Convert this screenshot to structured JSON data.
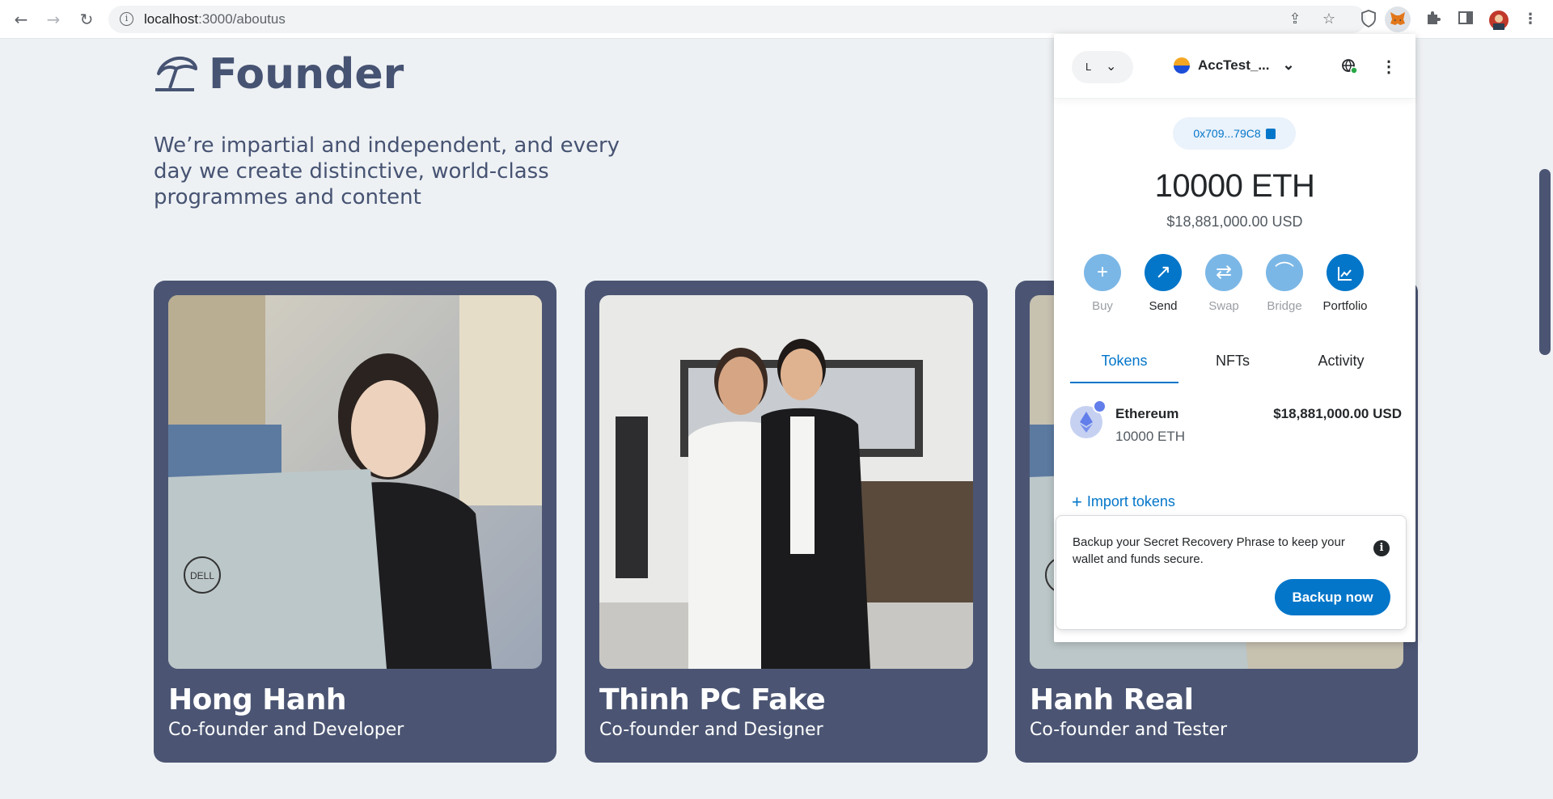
{
  "browser": {
    "url_host": "localhost",
    "url_path": ":3000/aboutus"
  },
  "page": {
    "title": "Founder",
    "intro": "We’re impartial and independent, and every day we create distinctive, world-class programmes and content",
    "founders": [
      {
        "name": "Hong Hanh",
        "role": "Co-founder and Developer"
      },
      {
        "name": "Thinh PC Fake",
        "role": "Co-founder and Designer"
      },
      {
        "name": "Hanh Real",
        "role": "Co-founder and Tester"
      }
    ]
  },
  "wallet": {
    "network_letter": "L",
    "account_name": "AccTest_...",
    "address_short": "0x709...79C8",
    "balance": "10000 ETH",
    "fiat_balance": "$18,881,000.00 USD",
    "actions": [
      {
        "label": "Buy",
        "icon": "plus-icon",
        "enabled": false
      },
      {
        "label": "Send",
        "icon": "arrow-up-right-icon",
        "enabled": true
      },
      {
        "label": "Swap",
        "icon": "swap-arrows-icon",
        "enabled": false
      },
      {
        "label": "Bridge",
        "icon": "bridge-icon",
        "enabled": false
      },
      {
        "label": "Portfolio",
        "icon": "chart-icon",
        "enabled": true
      }
    ],
    "tabs": [
      "Tokens",
      "NFTs",
      "Activity"
    ],
    "active_tab": "Tokens",
    "tokens": [
      {
        "name": "Ethereum",
        "amount": "10000 ETH",
        "fiat": "$18,881,000.00 USD"
      }
    ],
    "import_label": "Import tokens",
    "backup_message": "Backup your Secret Recovery Phrase to keep your wallet and funds secure.",
    "backup_button": "Backup now"
  },
  "colors": {
    "page_bg": "#eef1f4",
    "card_bg": "#4b5573",
    "heading": "#465372",
    "metamask_blue": "#0376c9"
  }
}
